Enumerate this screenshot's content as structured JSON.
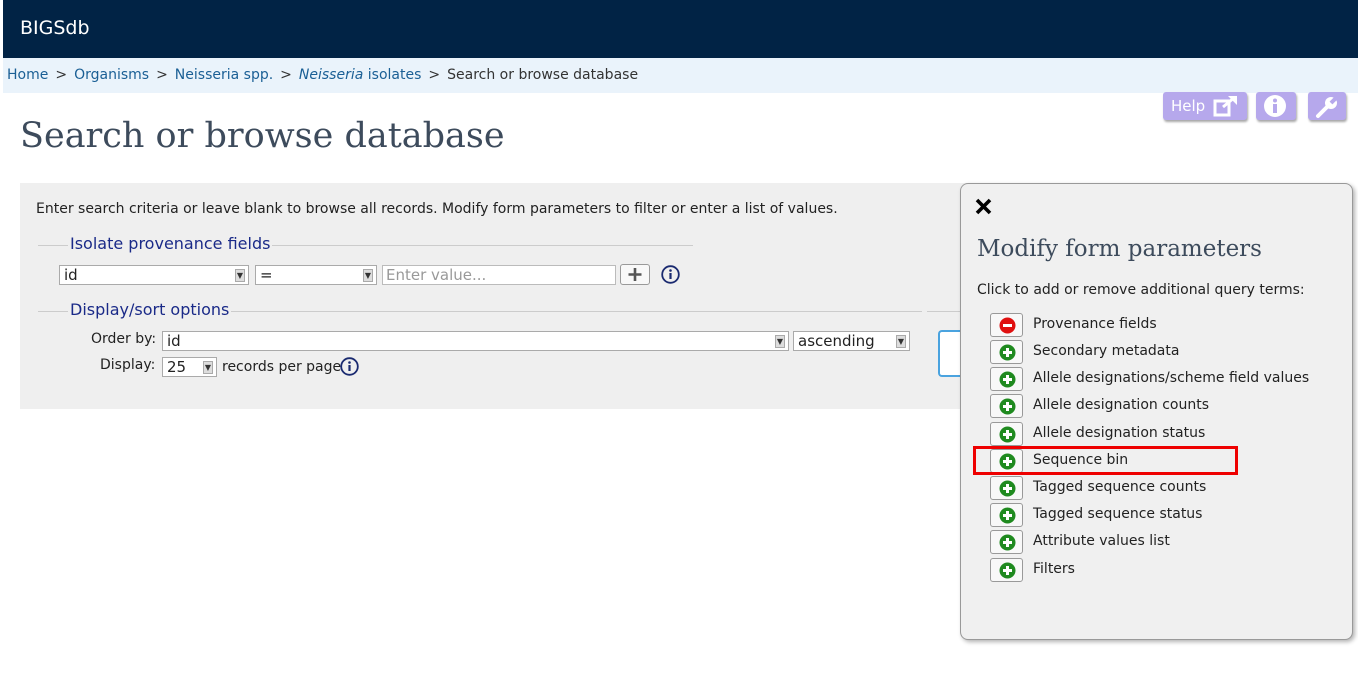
{
  "app": {
    "title": "BIGSdb"
  },
  "breadcrumb": {
    "items": [
      {
        "label": "Home"
      },
      {
        "label": "Organisms"
      },
      {
        "label": "Neisseria spp."
      },
      {
        "label_italic": "Neisseria",
        "label_rest": " isolates"
      },
      {
        "label": "Search or browse database"
      }
    ],
    "separator": ">"
  },
  "toolbar": {
    "help_label": "Help"
  },
  "page": {
    "title": "Search or browse database"
  },
  "query_form": {
    "instructions": "Enter search criteria or leave blank to browse all records. Modify form parameters to filter or enter a list of values.",
    "provenance_legend": "Isolate provenance fields",
    "field_value": "id",
    "operator_value": "=",
    "value_placeholder": "Enter value...",
    "display_legend": "Display/sort options",
    "order_by_label": "Order by:",
    "order_by_value": "id",
    "direction_value": "ascending",
    "display_label": "Display:",
    "display_value": "25",
    "records_per_page": "records per page"
  },
  "modify_panel": {
    "title": "Modify form parameters",
    "subtitle": "Click to add or remove additional query terms:",
    "items": [
      {
        "label": "Provenance fields",
        "state": "remove"
      },
      {
        "label": "Secondary metadata",
        "state": "add"
      },
      {
        "label": "Allele designations/scheme field values",
        "state": "add"
      },
      {
        "label": "Allele designation counts",
        "state": "add"
      },
      {
        "label": "Allele designation status",
        "state": "add"
      },
      {
        "label": "Sequence bin",
        "state": "add"
      },
      {
        "label": "Tagged sequence counts",
        "state": "add"
      },
      {
        "label": "Tagged sequence status",
        "state": "add"
      },
      {
        "label": "Attribute values list",
        "state": "add"
      },
      {
        "label": "Filters",
        "state": "add"
      }
    ]
  },
  "colors": {
    "topbar": "#012345",
    "breadcrumb_bg": "#eaf3fb",
    "toolbar_button": "#b6a8ec",
    "add_icon": "#1f8a1f",
    "remove_icon": "#e01010",
    "highlight": "#ee0000"
  }
}
